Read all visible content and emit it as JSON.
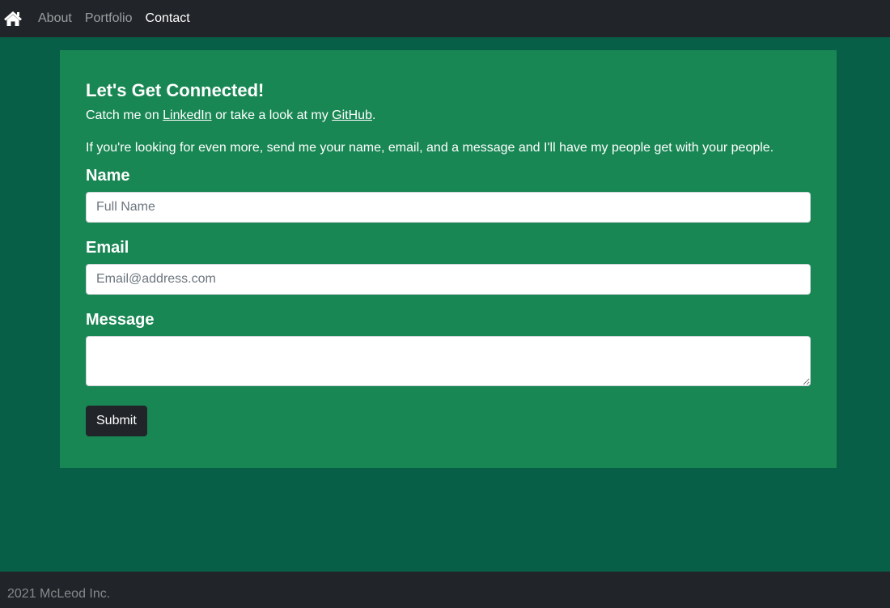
{
  "nav": {
    "home_icon": "home-icon",
    "links": [
      {
        "label": "About",
        "active": false
      },
      {
        "label": "Portfolio",
        "active": false
      },
      {
        "label": "Contact",
        "active": true
      }
    ]
  },
  "contact": {
    "title": "Let's Get Connected!",
    "intro_prefix": "Catch me on ",
    "linkedin_label": "LinkedIn",
    "intro_middle": " or take a look at my ",
    "github_label": "GitHub",
    "intro_suffix": ".",
    "more_text": "If you're looking for even more, send me your name, email, and a message and I'll have my people get with your people.",
    "form": {
      "name_label": "Name",
      "name_placeholder": "Full Name",
      "name_value": "",
      "email_label": "Email",
      "email_placeholder": "Email@address.com",
      "email_value": "",
      "message_label": "Message",
      "message_value": "",
      "submit_label": "Submit"
    }
  },
  "footer": {
    "text": "2021 McLeod Inc."
  },
  "colors": {
    "navbar": "#212529",
    "page_background": "#075f48",
    "card_background": "#198754",
    "button": "#212529"
  }
}
